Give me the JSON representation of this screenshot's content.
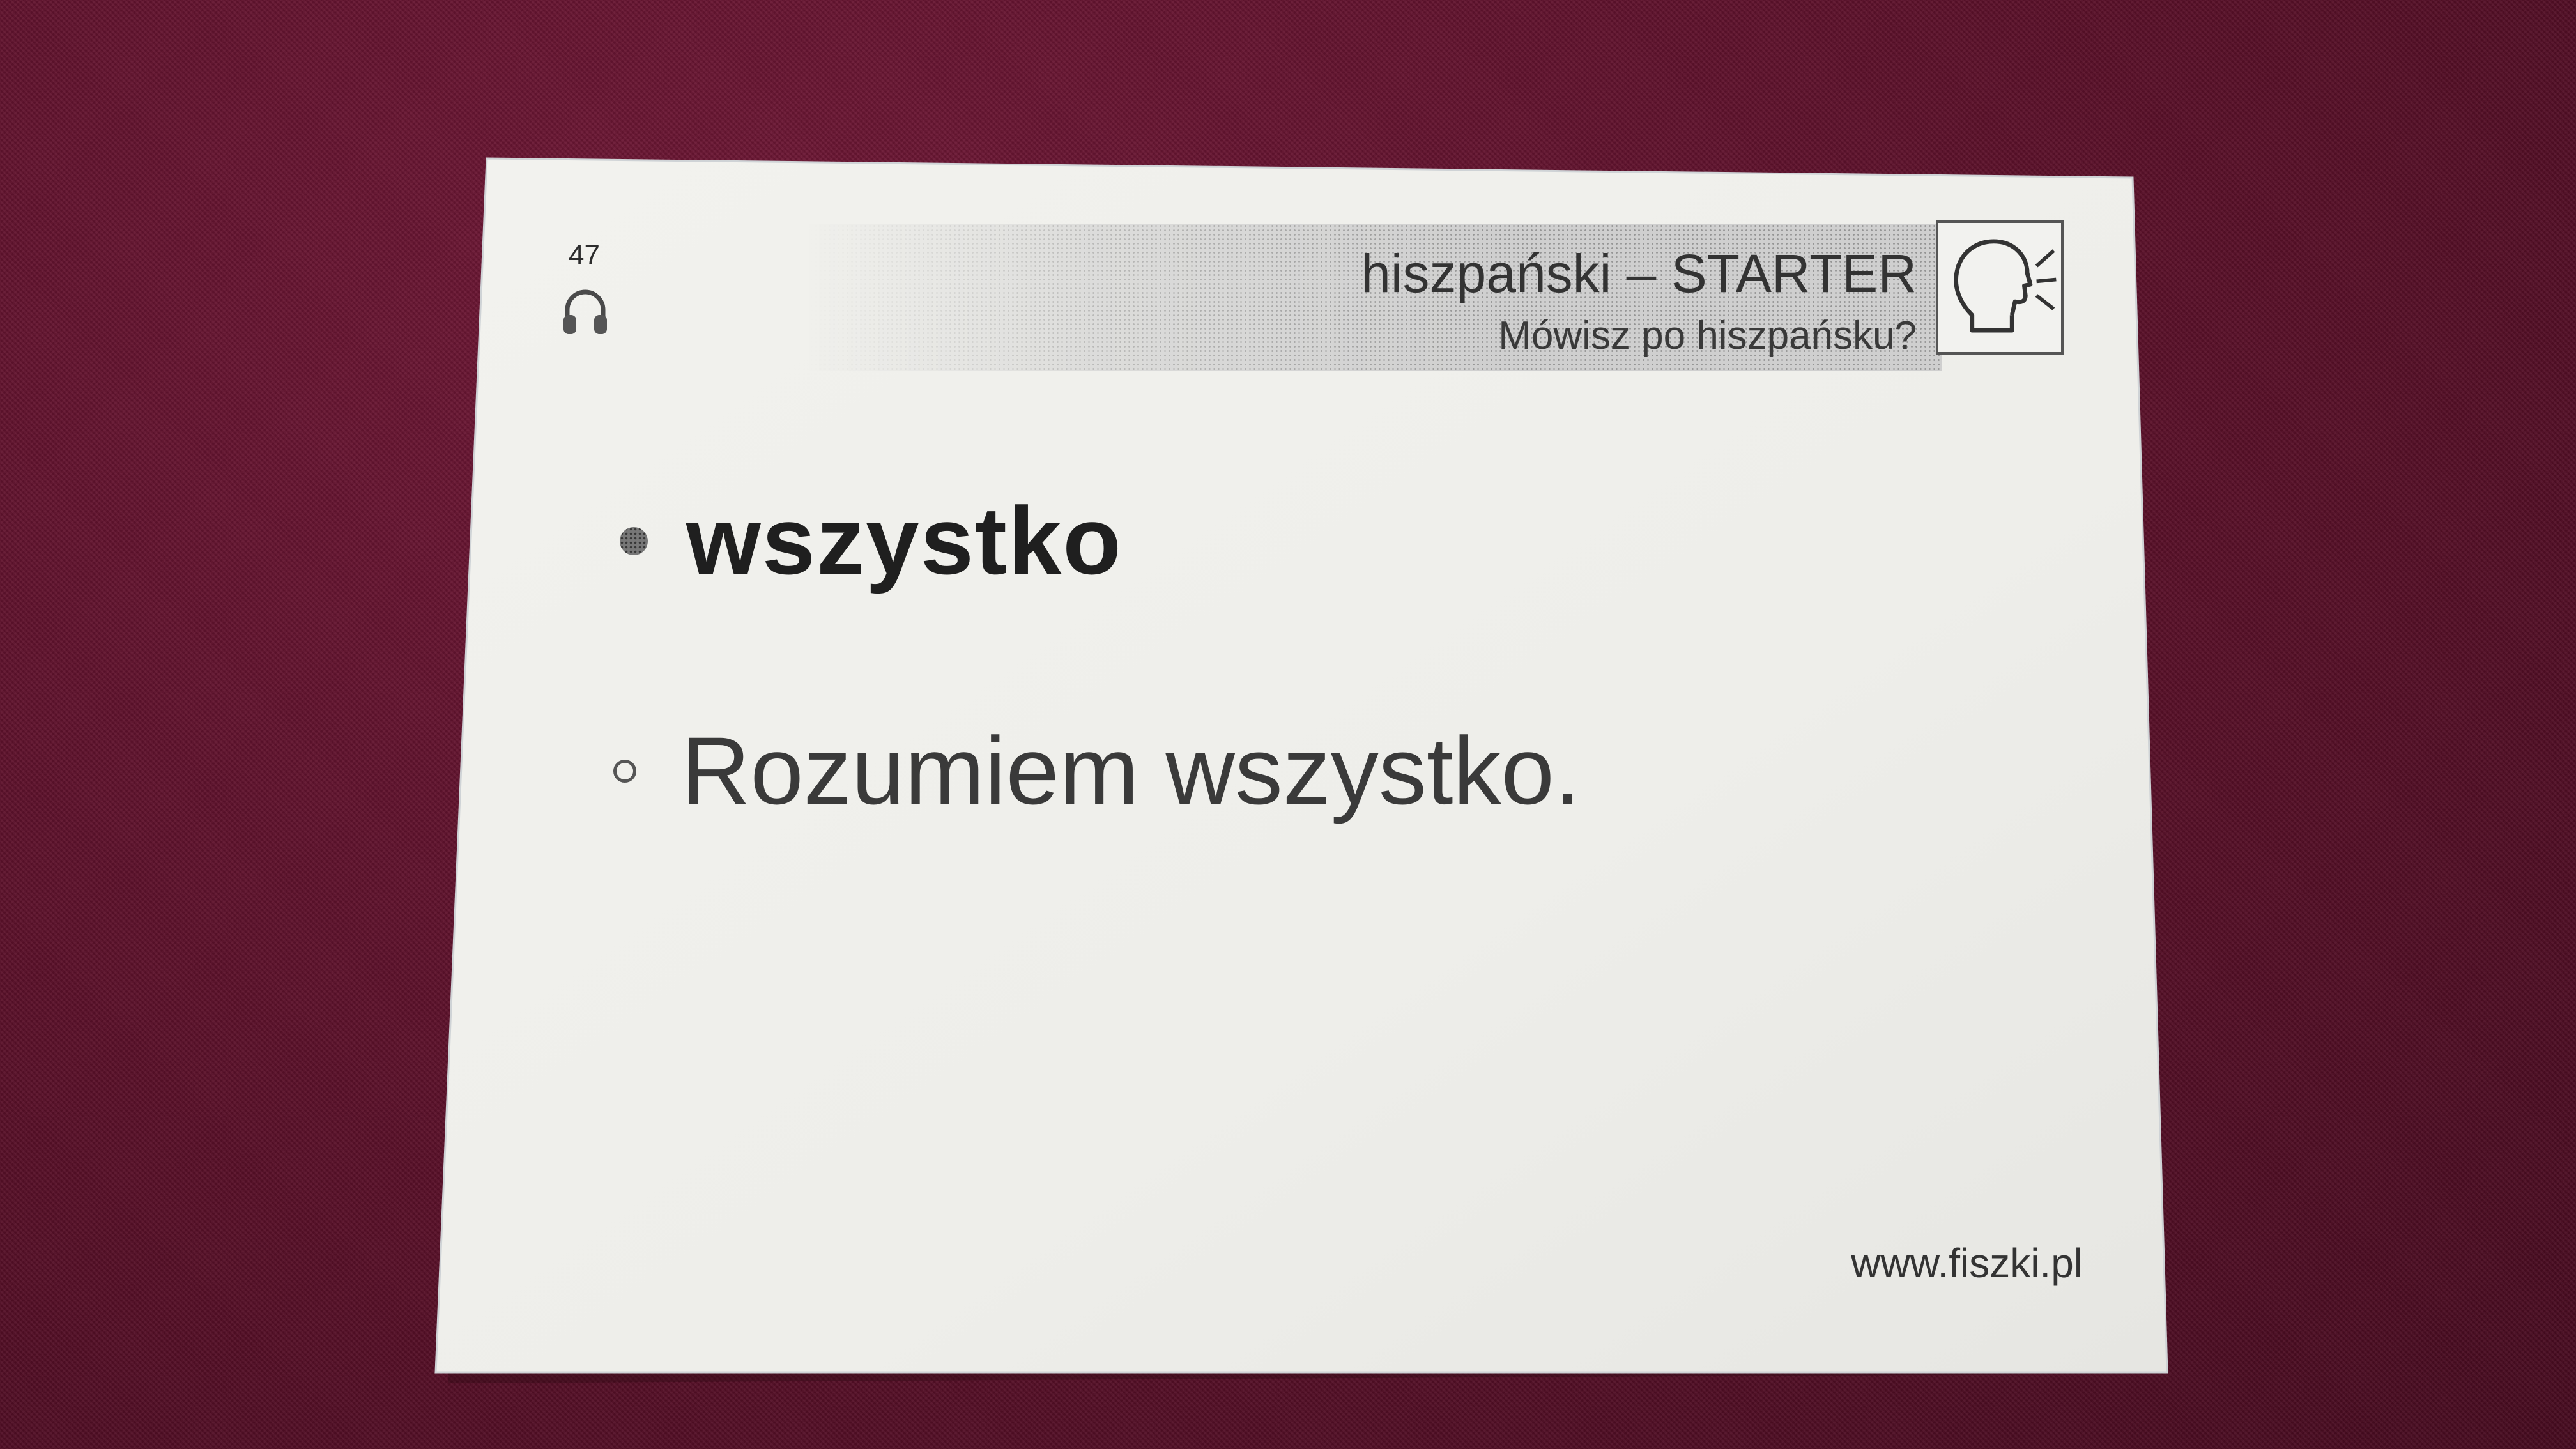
{
  "card": {
    "number": "47",
    "title": "hiszpański – STARTER",
    "subtitle": "Mówisz po hiszpańsku?",
    "word": "wszystko",
    "sentence": "Rozumiem wszystko.",
    "website": "www.fiszki.pl",
    "icons": {
      "audio": "headphones-icon",
      "speaking": "speaking-head-icon"
    }
  },
  "colors": {
    "background": "#5a1029",
    "card": "#eeeeea",
    "text": "#1f1f1f",
    "header_band": "#cfcfcf"
  }
}
